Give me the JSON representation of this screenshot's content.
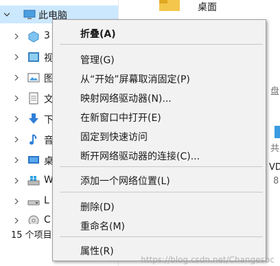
{
  "nav_pane": {
    "root_label": "此电脑",
    "items": [
      {
        "label": "3",
        "icon": "3d-objects-icon"
      },
      {
        "label": "视",
        "icon": "videos-icon"
      },
      {
        "label": "图",
        "icon": "pictures-icon"
      },
      {
        "label": "文",
        "icon": "documents-icon"
      },
      {
        "label": "下",
        "icon": "downloads-icon"
      },
      {
        "label": "音",
        "icon": "music-icon"
      },
      {
        "label": "桌",
        "icon": "desktop-icon"
      },
      {
        "label": "W",
        "icon": "windows-drive-icon"
      },
      {
        "label": "L",
        "icon": "local-drive-icon"
      },
      {
        "label": "C",
        "icon": "cd-drive-icon"
      }
    ]
  },
  "status_bar": {
    "text": "15 个项目"
  },
  "content_pane": {
    "desktop_label": "桌面",
    "peek_text_1": "盘",
    "peek_text_2": "共",
    "peek_text_3": "VD",
    "peek_text_4": "8"
  },
  "context_menu": {
    "items": [
      {
        "label": "折叠(A)",
        "bold": true
      },
      {
        "label": "管理(G)"
      },
      {
        "label": "从“开始”屏幕取消固定(P)"
      },
      {
        "label": "映射网络驱动器(N)..."
      },
      {
        "label": "在新窗口中打开(E)"
      },
      {
        "label": "固定到快速访问"
      },
      {
        "label": "断开网络驱动器的连接(C)..."
      },
      {
        "label": "添加一个网络位置(L)"
      },
      {
        "label": "删除(D)"
      },
      {
        "label": "重命名(M)"
      },
      {
        "label": "属性(R)"
      }
    ]
  },
  "watermark": "https://blog.csdn.net/Changesbc",
  "colors": {
    "selected_row": "#cce8ff",
    "menu_bg": "#f2f2f2",
    "menu_border": "#a0a0a0"
  }
}
